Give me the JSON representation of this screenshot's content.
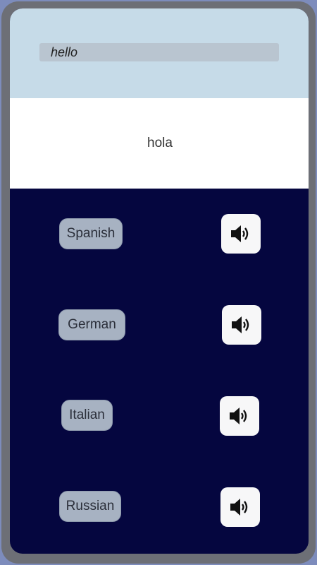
{
  "input": {
    "value": "hello",
    "placeholder": ""
  },
  "output": {
    "text": "hola"
  },
  "languages": [
    {
      "label": "Spanish"
    },
    {
      "label": "German"
    },
    {
      "label": "Italian"
    },
    {
      "label": "Russian"
    }
  ],
  "icons": {
    "speak": "speaker-icon"
  },
  "colors": {
    "background": "#7d8cbc",
    "frame": "#6d6f76",
    "screen": "#05063f",
    "input_panel": "#c6dbe8",
    "input_bar": "#b9c5d0",
    "output_panel": "#ffffff",
    "language_button": "#a7b2c2",
    "speak_button": "#f7f7f8"
  }
}
